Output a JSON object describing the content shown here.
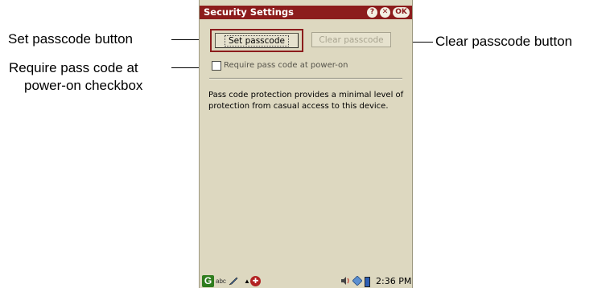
{
  "callouts": {
    "set_passcode": "Set passcode button",
    "require_line1": "Require pass code at",
    "require_line2": "power-on checkbox",
    "clear_passcode": "Clear passcode button"
  },
  "window": {
    "title": "Security Settings",
    "help_label": "?",
    "close_label": "✕",
    "ok_label": "OK"
  },
  "buttons": {
    "set_passcode": "Set passcode",
    "clear_passcode": "Clear passcode"
  },
  "checkbox": {
    "label": "Require pass code at power-on",
    "checked": false
  },
  "description": "Pass code protection provides a minimal level of protection from casual access to this device.",
  "taskbar": {
    "start_icon": "G",
    "input_mode": "abc",
    "pen_icon": "pen-icon",
    "up_icon": "▲",
    "clock": "2:36 PM"
  }
}
